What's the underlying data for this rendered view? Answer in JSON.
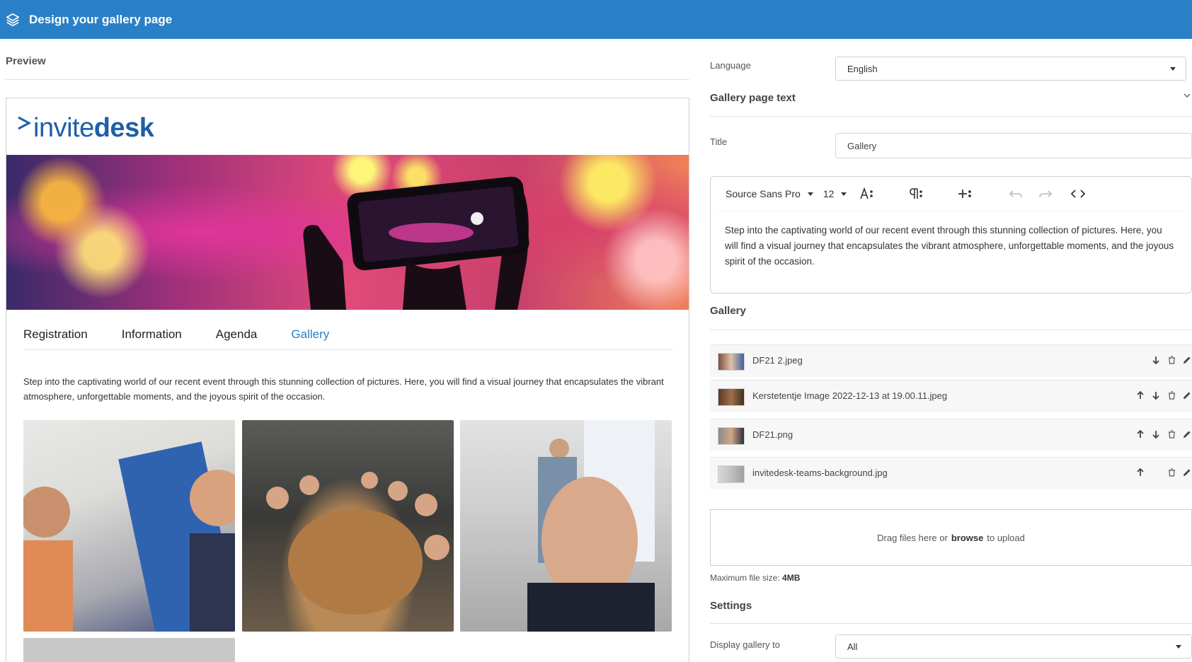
{
  "header": {
    "title": "Design your gallery page"
  },
  "preview": {
    "label": "Preview",
    "brand": {
      "part1": "invite",
      "part2": "desk"
    },
    "tabs": [
      {
        "label": "Registration"
      },
      {
        "label": "Information"
      },
      {
        "label": "Agenda"
      },
      {
        "label": "Gallery"
      }
    ],
    "active_tab": "Gallery",
    "description": "Step into the captivating world of our recent event through this stunning collection of pictures. Here, you will find a visual journey that encapsulates the vibrant atmosphere, unforgettable moments, and the joyous spirit of the occasion."
  },
  "settings": {
    "language_label": "Language",
    "language_value": "English",
    "page_text_title": "Gallery page text",
    "title_label": "Title",
    "title_value": "Gallery",
    "editor": {
      "font": "Source Sans Pro",
      "size": "12",
      "text": "Step into the captivating world of our recent event through this stunning collection of pictures. Here, you will find a visual journey that encapsulates the vibrant atmosphere, unforgettable moments, and the joyous spirit of the occasion."
    },
    "gallery_title": "Gallery",
    "files": [
      {
        "name": "DF21 2.jpeg"
      },
      {
        "name": "Kerstetentje Image 2022-12-13 at 19.00.11.jpeg"
      },
      {
        "name": "DF21.png"
      },
      {
        "name": "invitedesk-teams-background.jpg"
      }
    ],
    "dropzone": {
      "text_before": "Drag files here or",
      "browse": "browse",
      "text_after": "to upload"
    },
    "max_file_size_label": "Maximum file size:",
    "max_file_size_value": "4MB",
    "settings_title": "Settings",
    "display_label": "Display gallery to",
    "display_value": "All"
  },
  "colors": {
    "header": "#2a80c6",
    "accent": "#2a80c6",
    "brand": "#1f5fa8"
  }
}
